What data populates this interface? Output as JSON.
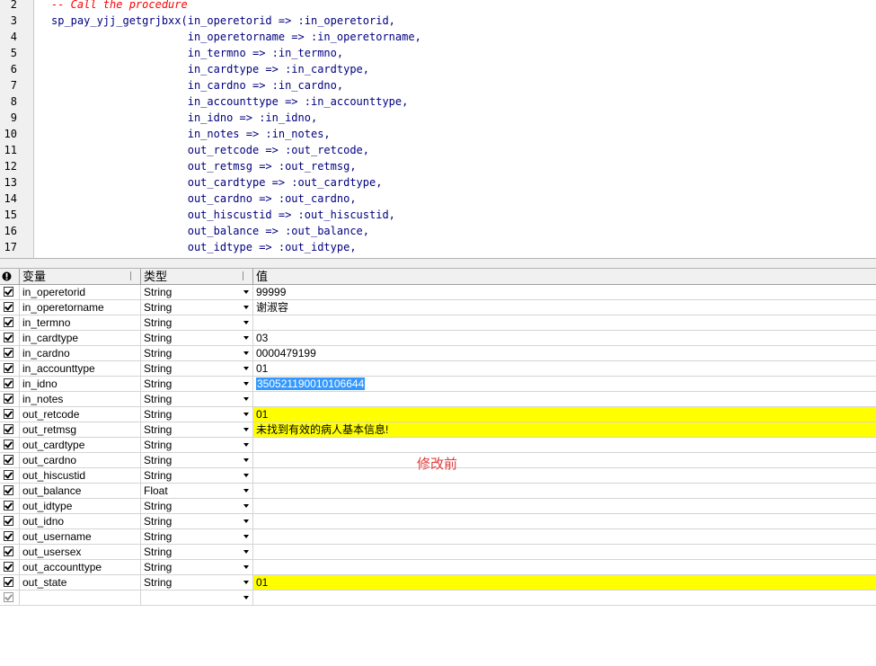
{
  "editor": {
    "lines": [
      {
        "no": "2",
        "text": "-- Call the procedure",
        "kind": "comment"
      },
      {
        "no": "3",
        "text": "sp_pay_yjj_getgrjbxx(in_operetorid => :in_operetorid,",
        "kind": "code"
      },
      {
        "no": "4",
        "text": "                     in_operetorname => :in_operetorname,",
        "kind": "code"
      },
      {
        "no": "5",
        "text": "                     in_termno => :in_termno,",
        "kind": "code"
      },
      {
        "no": "6",
        "text": "                     in_cardtype => :in_cardtype,",
        "kind": "code"
      },
      {
        "no": "7",
        "text": "                     in_cardno => :in_cardno,",
        "kind": "code"
      },
      {
        "no": "8",
        "text": "                     in_accounttype => :in_accounttype,",
        "kind": "code"
      },
      {
        "no": "9",
        "text": "                     in_idno => :in_idno,",
        "kind": "code"
      },
      {
        "no": "10",
        "text": "                     in_notes => :in_notes,",
        "kind": "code"
      },
      {
        "no": "11",
        "text": "                     out_retcode => :out_retcode,",
        "kind": "code"
      },
      {
        "no": "12",
        "text": "                     out_retmsg => :out_retmsg,",
        "kind": "code"
      },
      {
        "no": "13",
        "text": "                     out_cardtype => :out_cardtype,",
        "kind": "code"
      },
      {
        "no": "14",
        "text": "                     out_cardno => :out_cardno,",
        "kind": "code"
      },
      {
        "no": "15",
        "text": "                     out_hiscustid => :out_hiscustid,",
        "kind": "code"
      },
      {
        "no": "16",
        "text": "                     out_balance => :out_balance,",
        "kind": "code"
      },
      {
        "no": "17",
        "text": "                     out_idtype => :out_idtype,",
        "kind": "code"
      }
    ]
  },
  "grid": {
    "header": {
      "variable": "变量",
      "type": "类型",
      "value": "值",
      "icon": "info-circle-icon"
    },
    "rows": [
      {
        "var": "in_operetorid",
        "type": "String",
        "value": "99999",
        "highlight": false,
        "selected": false
      },
      {
        "var": "in_operetorname",
        "type": "String",
        "value": "谢淑容",
        "highlight": false,
        "selected": false
      },
      {
        "var": "in_termno",
        "type": "String",
        "value": "",
        "highlight": false,
        "selected": false
      },
      {
        "var": "in_cardtype",
        "type": "String",
        "value": "03",
        "highlight": false,
        "selected": false
      },
      {
        "var": "in_cardno",
        "type": "String",
        "value": "0000479199",
        "highlight": false,
        "selected": false
      },
      {
        "var": "in_accounttype",
        "type": "String",
        "value": "01",
        "highlight": false,
        "selected": false
      },
      {
        "var": "in_idno",
        "type": "String",
        "value": "350521190010106644",
        "highlight": false,
        "selected": true
      },
      {
        "var": "in_notes",
        "type": "String",
        "value": "",
        "highlight": false,
        "selected": false
      },
      {
        "var": "out_retcode",
        "type": "String",
        "value": "01",
        "highlight": true,
        "selected": false
      },
      {
        "var": "out_retmsg",
        "type": "String",
        "value": "未找到有效的病人基本信息!",
        "highlight": true,
        "selected": false
      },
      {
        "var": "out_cardtype",
        "type": "String",
        "value": "",
        "highlight": false,
        "selected": false
      },
      {
        "var": "out_cardno",
        "type": "String",
        "value": "",
        "highlight": false,
        "selected": false
      },
      {
        "var": "out_hiscustid",
        "type": "String",
        "value": "",
        "highlight": false,
        "selected": false
      },
      {
        "var": "out_balance",
        "type": "Float",
        "value": "",
        "highlight": false,
        "selected": false
      },
      {
        "var": "out_idtype",
        "type": "String",
        "value": "",
        "highlight": false,
        "selected": false
      },
      {
        "var": "out_idno",
        "type": "String",
        "value": "",
        "highlight": false,
        "selected": false
      },
      {
        "var": "out_username",
        "type": "String",
        "value": "",
        "highlight": false,
        "selected": false
      },
      {
        "var": "out_usersex",
        "type": "String",
        "value": "",
        "highlight": false,
        "selected": false
      },
      {
        "var": "out_accounttype",
        "type": "String",
        "value": "",
        "highlight": false,
        "selected": false
      },
      {
        "var": "out_state",
        "type": "String",
        "value": "01",
        "highlight": true,
        "selected": false
      }
    ],
    "highlight_color": "#ffff00",
    "selection_color": "#3399ff"
  },
  "annotation": {
    "text": "修改前",
    "color": "#e03c3c"
  }
}
